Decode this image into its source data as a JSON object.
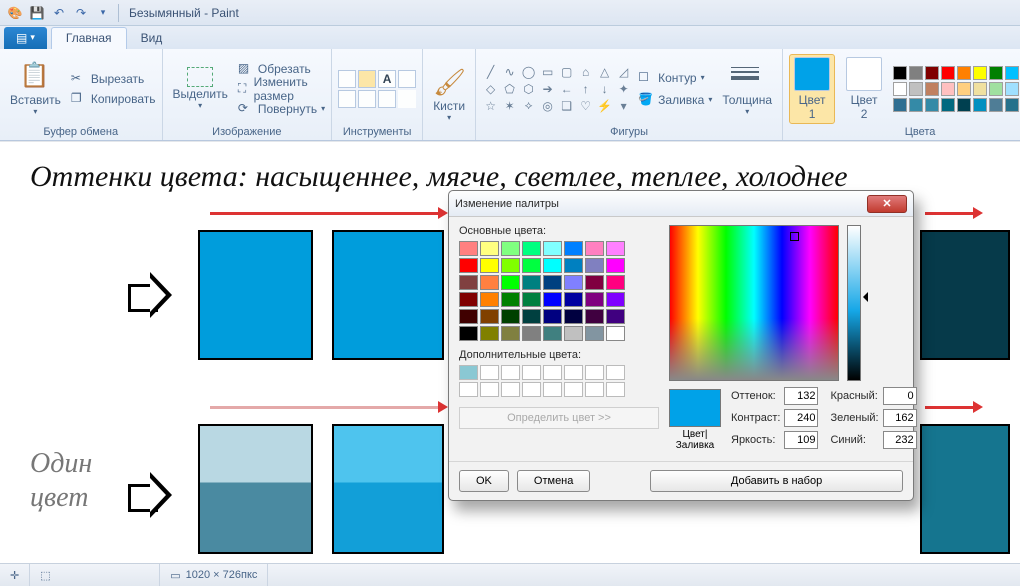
{
  "titlebar": {
    "doc": "Безымянный",
    "app": "Paint"
  },
  "tabs": {
    "file": "",
    "home": "Главная",
    "view": "Вид"
  },
  "groups": {
    "clipboard": "Буфер обмена",
    "image": "Изображение",
    "tools": "Инструменты",
    "shapes": "Фигуры",
    "colors": "Цвета"
  },
  "clipboard": {
    "paste": "Вставить",
    "cut": "Вырезать",
    "copy": "Копировать"
  },
  "image": {
    "select": "Выделить",
    "crop": "Обрезать",
    "resize": "Изменить размер",
    "rotate": "Повернуть"
  },
  "brush": {
    "label": "Кисти"
  },
  "shapes_panel": {
    "outline": "Контур",
    "fill": "Заливка",
    "thickness": "Толщина"
  },
  "color_slots": {
    "c1_label": "Цвет",
    "c1_n": "1",
    "c2_label": "Цвет",
    "c2_n": "2",
    "c1": "#00a2e8",
    "c2": "#ffffff"
  },
  "palette_row1": [
    "#000000",
    "#808080",
    "#800000",
    "#ff0000",
    "#ff8000",
    "#ffff00",
    "#008000",
    "#00c0ff",
    "#0000ff",
    "#800080"
  ],
  "palette_row2": [
    "#ffffff",
    "#c0c0c0",
    "#c08060",
    "#ffc0c0",
    "#ffcf80",
    "#f0e0a0",
    "#a0e0a0",
    "#a0e0ff",
    "#8090c0",
    "#c8a0d8"
  ],
  "palette_row3": [
    "#2f6e91",
    "#348aa7",
    "#348aa7",
    "#006980",
    "#004050",
    "#0090c0",
    "#4f7d96",
    "#26718c",
    "#1a5d73",
    "#3f8aa7"
  ],
  "stage": {
    "headline": "Оттенки цвета: насыщеннее, мягче, светлее, теплее, холоднее",
    "side1": "Один",
    "side2": "цвет"
  },
  "dialog": {
    "title": "Изменение палитры",
    "basic": "Основные цвета:",
    "custom": "Дополнительные цвета:",
    "define": "Определить цвет >>",
    "preview": "Цвет|Заливка",
    "hue_l": "Оттенок:",
    "sat_l": "Контраст:",
    "lum_l": "Яркость:",
    "red_l": "Красный:",
    "green_l": "Зеленый:",
    "blue_l": "Синий:",
    "hue": "132",
    "sat": "240",
    "lum": "109",
    "red": "0",
    "green": "162",
    "blue": "232",
    "ok": "OK",
    "cancel": "Отмена",
    "add": "Добавить в набор"
  },
  "basic_colors": [
    "#ff8080",
    "#ffff80",
    "#80ff80",
    "#00ff80",
    "#80ffff",
    "#0080ff",
    "#ff80c0",
    "#ff80ff",
    "#ff0000",
    "#ffff00",
    "#80ff00",
    "#00ff40",
    "#00ffff",
    "#0080c0",
    "#8080c0",
    "#ff00ff",
    "#804040",
    "#ff8040",
    "#00ff00",
    "#008080",
    "#004080",
    "#8080ff",
    "#800040",
    "#ff0080",
    "#800000",
    "#ff8000",
    "#008000",
    "#008040",
    "#0000ff",
    "#0000a0",
    "#800080",
    "#8000ff",
    "#400000",
    "#804000",
    "#004000",
    "#004040",
    "#000080",
    "#000040",
    "#400040",
    "#400080",
    "#000000",
    "#808000",
    "#808040",
    "#808080",
    "#408080",
    "#c0c0c0",
    "#8295a1",
    "#ffffff"
  ],
  "status": {
    "dims": "1020 × 726пкс"
  }
}
